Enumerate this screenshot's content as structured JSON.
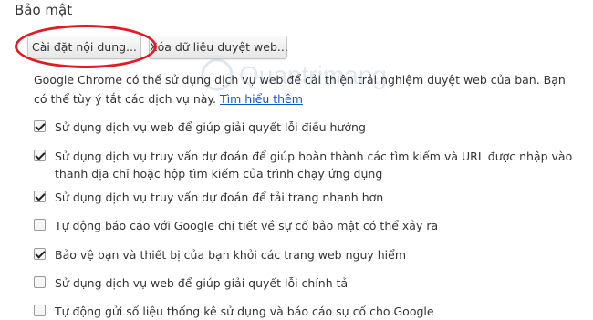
{
  "section": {
    "title": "Bảo mật"
  },
  "buttons": {
    "content_settings": "Cài đặt nội dung...",
    "clear_browsing": "Xóa dữ liệu duyệt web..."
  },
  "description": {
    "text": "Google Chrome có thể sử dụng dịch vụ web để cải thiện trải nghiệm duyệt web của bạn. Bạn có thể tùy ý tắt các dịch vụ này.",
    "link": "Tìm hiểu thêm"
  },
  "watermark": {
    "text": "Quantrimang"
  },
  "options": [
    {
      "label": "Sử dụng dịch vụ web để giúp giải quyết lỗi điều hướng",
      "checked": true
    },
    {
      "label": "Sử dụng dịch vụ truy vấn dự đoán để giúp hoàn thành các tìm kiếm và URL được nhập vào thanh địa chỉ hoặc hộp tìm kiếm của trình chạy ứng dụng",
      "checked": true
    },
    {
      "label": "Sử dụng dịch vụ truy vấn dự đoán để tải trang nhanh hơn",
      "checked": true
    },
    {
      "label": "Tự động báo cáo với Google chi tiết về sự cố bảo mật có thể xảy ra",
      "checked": false
    },
    {
      "label": "Bảo vệ bạn và thiết bị của bạn khỏi các trang web nguy hiểm",
      "checked": true
    },
    {
      "label": "Sử dụng dịch vụ web để giúp giải quyết lỗi chính tả",
      "checked": false
    },
    {
      "label": "Tự động gửi số liệu thống kê sử dụng và báo cáo sự cố cho Google",
      "checked": false
    }
  ],
  "colors": {
    "highlight": "#e01b24",
    "link": "#1155cc"
  }
}
